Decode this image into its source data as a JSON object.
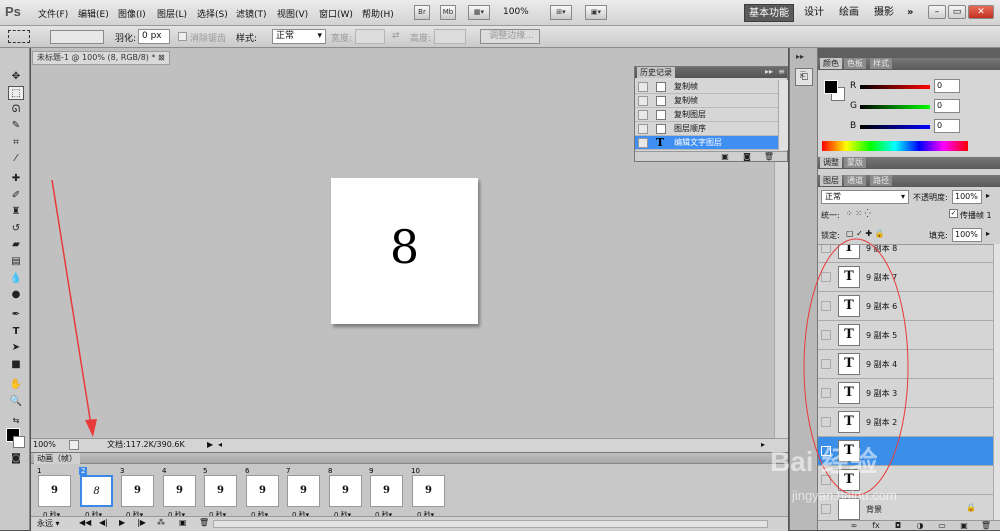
{
  "app_logo": "Ps",
  "menus": [
    "文件(F)",
    "编辑(E)",
    "图像(I)",
    "图层(L)",
    "选择(S)",
    "滤镜(T)",
    "视图(V)",
    "窗口(W)",
    "帮助(H)"
  ],
  "menubar_icons": [
    "Br",
    "Mb"
  ],
  "zoom_dropdown": "100%",
  "workspaces": {
    "active": "基本功能",
    "others": [
      "设计",
      "绘画",
      "摄影"
    ],
    "more": "»"
  },
  "window_controls": [
    "–",
    "▭",
    "✕"
  ],
  "options": {
    "feather_label": "羽化:",
    "feather_value": "0 px",
    "antialias_label": "消除锯齿",
    "style_label": "样式:",
    "style_value": "正常",
    "width_label": "宽度:",
    "height_label": "高度:",
    "refine_button": "调整边缘..."
  },
  "document": {
    "tab_title": "未标题-1 @ 100% (8, RGB/8) *",
    "canvas_text": "8",
    "zoom_value": "100%",
    "doc_info": "文档:117.2K/390.6K"
  },
  "history": {
    "tabs": [
      "历史记录"
    ],
    "items": [
      {
        "label": "复制帧",
        "selected": false
      },
      {
        "label": "复制帧",
        "selected": false
      },
      {
        "label": "复制图层",
        "selected": false
      },
      {
        "label": "图层顺序",
        "selected": false
      },
      {
        "label": "编辑文字图层",
        "selected": true
      }
    ]
  },
  "animation": {
    "title": "动画（帧）",
    "frames": [
      {
        "num": "1",
        "digit": "9",
        "delay": "0 秒▾",
        "selected": false
      },
      {
        "num": "2",
        "digit": "8",
        "delay": "0 秒▾",
        "selected": true
      },
      {
        "num": "3",
        "digit": "9",
        "delay": "0 秒▾",
        "selected": false
      },
      {
        "num": "4",
        "digit": "9",
        "delay": "0 秒▾",
        "selected": false
      },
      {
        "num": "5",
        "digit": "9",
        "delay": "0 秒▾",
        "selected": false
      },
      {
        "num": "6",
        "digit": "9",
        "delay": "0 秒▾",
        "selected": false
      },
      {
        "num": "7",
        "digit": "9",
        "delay": "0 秒▾",
        "selected": false
      },
      {
        "num": "8",
        "digit": "9",
        "delay": "0 秒▾",
        "selected": false
      },
      {
        "num": "9",
        "digit": "9",
        "delay": "0 秒▾",
        "selected": false
      },
      {
        "num": "10",
        "digit": "9",
        "delay": "0 秒▾",
        "selected": false
      }
    ],
    "loop": "永远 ▾"
  },
  "color_panel": {
    "tabs": [
      "颜色",
      "色板",
      "样式"
    ],
    "r_label": "R",
    "g_label": "G",
    "b_label": "B",
    "r_value": "0",
    "g_value": "0",
    "b_value": "0"
  },
  "adjust_tabs": [
    "调整",
    "蒙版"
  ],
  "layers_panel": {
    "tabs": [
      "图层",
      "通道",
      "路径"
    ],
    "blend_mode": "正常",
    "opacity_label": "不透明度:",
    "opacity_value": "100%",
    "unify_label": "统一:",
    "propagate_label": "传播帧 1",
    "lock_label": "锁定:",
    "fill_label": "填充:",
    "fill_value": "100%",
    "layers": [
      {
        "name": "9 副本 8",
        "selected": false
      },
      {
        "name": "9 副本 7",
        "selected": false
      },
      {
        "name": "9 副本 6",
        "selected": false
      },
      {
        "name": "9 副本 5",
        "selected": false
      },
      {
        "name": "9 副本 4",
        "selected": false
      },
      {
        "name": "9 副本 3",
        "selected": false
      },
      {
        "name": "9 副本 2",
        "selected": false
      },
      {
        "name": "",
        "selected": true
      },
      {
        "name": "",
        "selected": false
      },
      {
        "name": "背景",
        "selected": false
      }
    ]
  },
  "watermark": {
    "text": "Bai 经验",
    "url": "jingyan.baidu.com"
  },
  "colors": {
    "accent": "#3b8fe9",
    "annotation_red": "#e83a3a"
  }
}
